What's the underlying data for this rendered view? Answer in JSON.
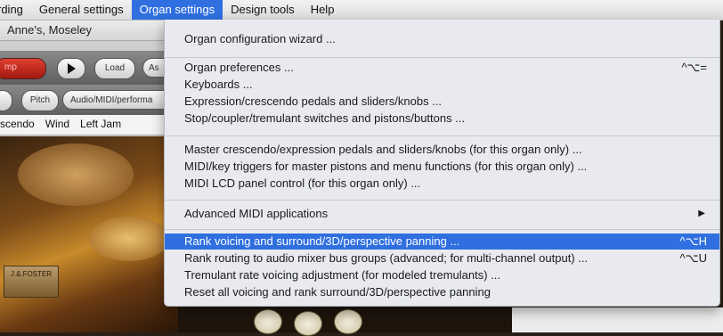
{
  "menubar": {
    "items": [
      {
        "label": "rding"
      },
      {
        "label": "General settings"
      },
      {
        "label": "Organ settings"
      },
      {
        "label": "Design tools"
      },
      {
        "label": "Help"
      }
    ]
  },
  "app": {
    "title": "Anne's, Moseley",
    "toolbar1": {
      "red_label": "mp",
      "load": "Load",
      "partial": "As"
    },
    "toolbar2": {
      "pitch": "Pitch",
      "audio": "Audio/MIDI/performa"
    },
    "tabs": [
      "scendo",
      "Wind",
      "Left Jam"
    ],
    "plaque_text": "J.&.FOSTER"
  },
  "menu": {
    "items": [
      {
        "label": "Organ configuration wizard ...",
        "shortcut": ""
      },
      {
        "label": "Organ preferences ...",
        "shortcut": "^⌥="
      },
      {
        "label": "Keyboards ...",
        "shortcut": ""
      },
      {
        "label": "Expression/crescendo pedals and sliders/knobs ...",
        "shortcut": ""
      },
      {
        "label": "Stop/coupler/tremulant switches and pistons/buttons ...",
        "shortcut": ""
      },
      {
        "label": "Master crescendo/expression pedals and sliders/knobs (for this organ only) ...",
        "shortcut": ""
      },
      {
        "label": "MIDI/key triggers for master pistons and menu functions (for this organ only) ...",
        "shortcut": ""
      },
      {
        "label": "MIDI LCD panel control (for this organ only) ...",
        "shortcut": ""
      },
      {
        "label": "Advanced MIDI applications",
        "shortcut": ""
      },
      {
        "label": "Rank voicing and surround/3D/perspective panning ...",
        "shortcut": "^⌥H"
      },
      {
        "label": "Rank routing to audio mixer bus groups (advanced; for multi-channel output) ...",
        "shortcut": "^⌥U"
      },
      {
        "label": "Tremulant rate voicing adjustment (for modeled tremulants) ...",
        "shortcut": ""
      },
      {
        "label": "Reset all voicing and rank surround/3D/perspective panning",
        "shortcut": ""
      }
    ],
    "submenu_arrow": "▶",
    "accent": "#2f6fe0"
  }
}
